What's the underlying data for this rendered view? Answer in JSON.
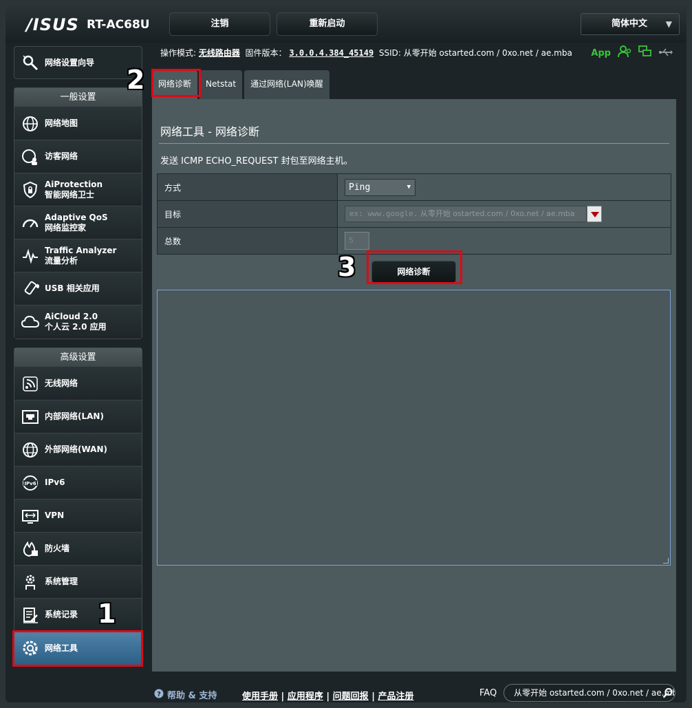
{
  "header": {
    "logo": "/ISUS",
    "model": "RT-AC68U",
    "logout_label": "注销",
    "reboot_label": "重新启动",
    "language": "简体中文"
  },
  "info": {
    "mode_label": "操作模式:",
    "mode_value": "无线路由器",
    "firmware_label": "固件版本：",
    "firmware_value": "3.0.0.4.384_45149",
    "ssid_label": "SSID:",
    "ssid_value": "从零开始 ostarted.com / 0xo.net / ae.mba",
    "app_label": "App"
  },
  "sidebar": {
    "wizard": "网络设置向导",
    "general_title": "一般设置",
    "general": [
      {
        "line1": "网络地图",
        "line2": ""
      },
      {
        "line1": "访客网络",
        "line2": ""
      },
      {
        "line1": "AiProtection",
        "line2": "智能网络卫士"
      },
      {
        "line1": "Adaptive QoS",
        "line2": "网络监控家"
      },
      {
        "line1": "Traffic Analyzer",
        "line2": "流量分析"
      },
      {
        "line1": "USB 相关应用",
        "line2": ""
      },
      {
        "line1": "AiCloud 2.0",
        "line2": "个人云 2.0 应用"
      }
    ],
    "advanced_title": "高级设置",
    "advanced": [
      {
        "line1": "无线网络"
      },
      {
        "line1": "内部网络(LAN)"
      },
      {
        "line1": "外部网络(WAN)"
      },
      {
        "line1": "IPv6"
      },
      {
        "line1": "VPN"
      },
      {
        "line1": "防火墙"
      },
      {
        "line1": "系统管理"
      },
      {
        "line1": "系统记录"
      },
      {
        "line1": "网络工具"
      }
    ]
  },
  "tabs": [
    "网络诊断",
    "Netstat",
    "通过网络(LAN)唤醒"
  ],
  "panel": {
    "title": "网络工具 - 网络诊断",
    "description": "发送 ICMP ECHO_REQUEST 封包至网络主机。",
    "rows": {
      "method_label": "方式",
      "method_value": "Ping",
      "target_label": "目标",
      "target_placeholder_mono": "ex: www.google.",
      "target_placeholder_text": "从零开始 ostarted.com / 0xo.net / ae.mba",
      "count_label": "总数",
      "count_value": "5"
    },
    "diagnose_button": "网络诊断"
  },
  "annotations": [
    "1",
    "2",
    "3"
  ],
  "footer": {
    "help": "帮助 & 支持",
    "links": [
      "使用手册",
      "应用程序",
      "问题回报",
      "产品注册"
    ],
    "faq": "FAQ",
    "search_text": "从零开始 ostarted.com / 0xo.net / ae.mba"
  },
  "colors": {
    "accent_red": "#e10915",
    "active_menu": "#2d5f86",
    "app_green": "#39c43a"
  }
}
